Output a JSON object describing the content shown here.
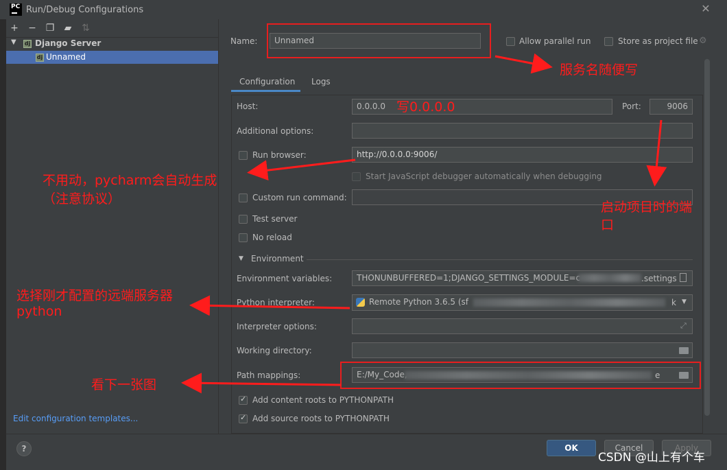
{
  "window": {
    "title": "Run/Debug Configurations",
    "logo": "PC"
  },
  "left_panel": {
    "toolbar": [
      "add-icon",
      "remove-icon",
      "copy-icon",
      "folder-add-icon",
      "sort-icon"
    ],
    "tree": {
      "group": "Django Server",
      "item": "Unnamed"
    },
    "footer_link": "Edit configuration templates..."
  },
  "header": {
    "name_label": "Name:",
    "name_value": "Unnamed",
    "allow_parallel": "Allow parallel run",
    "store_project": "Store as project file"
  },
  "tabs": [
    "Configuration",
    "Logs"
  ],
  "config": {
    "host_label": "Host:",
    "host_value": "0.0.0.0",
    "port_label": "Port:",
    "port_value": "9006",
    "additional_label": "Additional options:",
    "run_browser_label": "Run browser:",
    "run_browser_value": "http://0.0.0.0:9006/",
    "js_debugger_label": "Start JavaScript debugger automatically when debugging",
    "custom_run_label": "Custom run command:",
    "test_server_label": "Test server",
    "no_reload_label": "No reload",
    "environment_label": "Environment",
    "env_vars_label": "Environment variables:",
    "env_vars_value_start": "THONUNBUFFERED=1;DJANGO_SETTINGS_MODULE=c",
    "env_vars_value_end": ".settings",
    "interpreter_label": "Python interpreter:",
    "interpreter_value_start": "Remote Python 3.6.5 (sf",
    "interpreter_value_end": "k",
    "interp_options_label": "Interpreter options:",
    "working_dir_label": "Working directory:",
    "path_mappings_label": "Path mappings:",
    "path_mappings_value_start": "E:/My_Code,",
    "path_mappings_value_end": "e",
    "content_roots_label": "Add content roots to PYTHONPATH",
    "source_roots_label": "Add source roots to PYTHONPATH"
  },
  "buttons": {
    "ok": "OK",
    "cancel": "Cancel",
    "apply": "Apply",
    "help": "?"
  },
  "annotations": {
    "name_note": "服务名随便写",
    "host_note": "写0.0.0.0",
    "browser_note_1": "不用动，pycharm会自动生成",
    "browser_note_2": "（注意协议）",
    "port_note_1": "启动项目时的端",
    "port_note_2": "口",
    "interpreter_note_1": "选择刚才配置的远端服务器",
    "interpreter_note_2": "python",
    "path_note": "看下一张图"
  },
  "watermark": "CSDN @山上有个车",
  "colors": {
    "annotation_red": "#ff1c1c",
    "accent_blue": "#4a88c7",
    "selection": "#4b6eaf"
  }
}
